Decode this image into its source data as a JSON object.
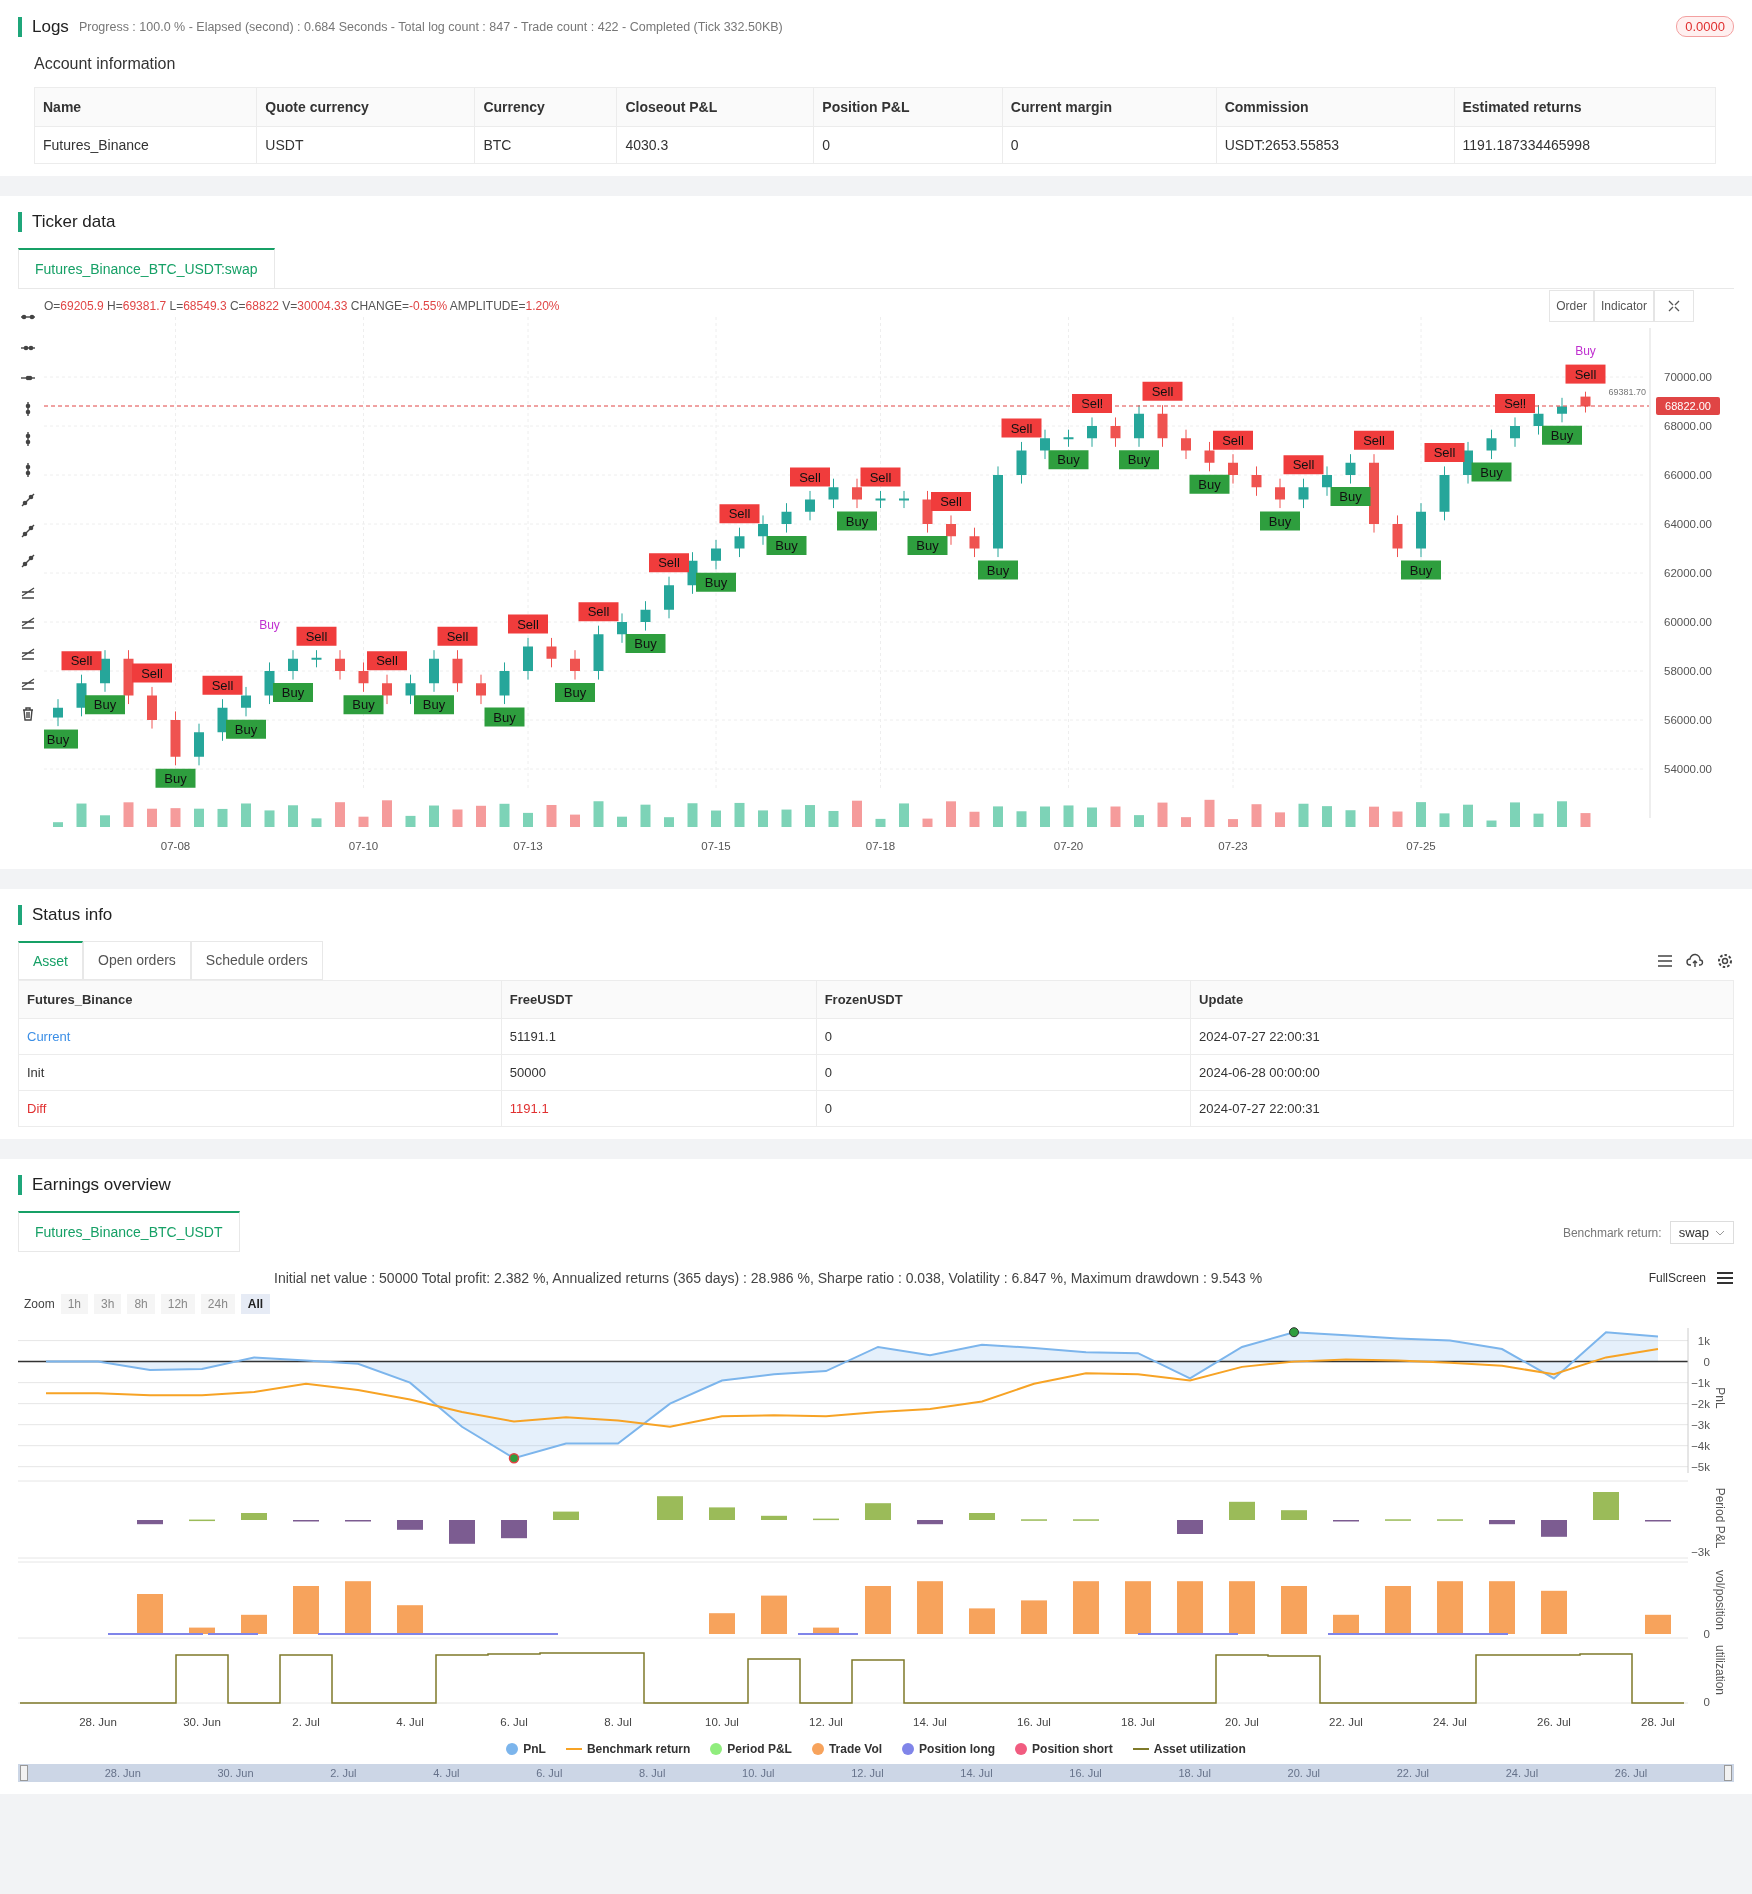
{
  "logs": {
    "title": "Logs",
    "stats": "Progress : 100.0 % - Elapsed (second) : 0.684  Seconds - Total log count : 847 - Trade count : 422 - Completed (Tick 332.50KB)",
    "badge": "0.0000"
  },
  "account": {
    "title": "Account information",
    "columns": [
      "Name",
      "Quote currency",
      "Currency",
      "Closeout P&L",
      "Position P&L",
      "Current margin",
      "Commission",
      "Estimated returns"
    ],
    "rows": [
      [
        "Futures_Binance",
        "USDT",
        "BTC",
        "4030.3",
        "0",
        "0",
        "USDT:2653.55853",
        "1191.187334465998"
      ]
    ]
  },
  "ticker": {
    "title": "Ticker data",
    "tab": "Futures_Binance_BTC_USDT:swap",
    "ohlc": [
      {
        "label": "O=",
        "value": "69205.9"
      },
      {
        "label": "H=",
        "value": "69381.7"
      },
      {
        "label": "L=",
        "value": "68549.3"
      },
      {
        "label": "C=",
        "value": "68822"
      },
      {
        "label": "V=",
        "value": "30004.33"
      },
      {
        "label": "CHANGE=",
        "value": "-0.55%"
      },
      {
        "label": "AMPLITUDE=",
        "value": "1.20%"
      }
    ],
    "buttons": [
      "Order",
      "Indicator"
    ],
    "high_label": "69381.70",
    "last_price": "68822.00",
    "chart_data": {
      "type": "candlestick",
      "grid": true,
      "ylim": [
        52000,
        72000
      ],
      "categories": [
        null,
        null,
        null,
        null,
        null,
        "07-08",
        null,
        null,
        null,
        null,
        null,
        null,
        null,
        "07-10",
        null,
        null,
        null,
        null,
        null,
        null,
        "07-13",
        null,
        null,
        null,
        null,
        null,
        null,
        null,
        "07-15",
        null,
        null,
        null,
        null,
        null,
        null,
        "07-18",
        null,
        null,
        null,
        null,
        null,
        null,
        null,
        "07-20",
        null,
        null,
        null,
        null,
        null,
        null,
        "07-23",
        null,
        null,
        null,
        null,
        null,
        null,
        null,
        "07-25",
        null,
        null,
        null,
        null,
        null,
        null,
        null
      ],
      "yticks": [
        {
          "value": 54000,
          "label": "54000.00"
        },
        {
          "value": 56000,
          "label": "56000.00"
        },
        {
          "value": 58000,
          "label": "58000.00"
        },
        {
          "value": 60000,
          "label": "60000.00"
        },
        {
          "value": 62000,
          "label": "62000.00"
        },
        {
          "value": 64000,
          "label": "64000.00"
        },
        {
          "value": 66000,
          "label": "66000.00"
        },
        {
          "value": 68000,
          "label": "68000.00"
        },
        {
          "value": 70000,
          "label": "70000.00"
        }
      ],
      "ohlc": [
        [
          56100,
          56850,
          55750,
          56500
        ],
        [
          56500,
          57850,
          56150,
          57500
        ],
        [
          57500,
          58850,
          57150,
          58500
        ],
        [
          58500,
          58850,
          56650,
          57000
        ],
        [
          57000,
          57350,
          55650,
          56000
        ],
        [
          56000,
          56350,
          54150,
          54500
        ],
        [
          54500,
          55850,
          54150,
          55500
        ],
        [
          55500,
          56850,
          55150,
          56500
        ],
        [
          56500,
          57350,
          56150,
          57000
        ],
        [
          57000,
          58350,
          56650,
          58000
        ],
        [
          58000,
          58850,
          57650,
          58500
        ],
        [
          58500,
          58850,
          58150,
          58500
        ],
        [
          58500,
          58850,
          57650,
          58000
        ],
        [
          58000,
          58350,
          57150,
          57500
        ],
        [
          57500,
          57850,
          56650,
          57000
        ],
        [
          57000,
          57850,
          56650,
          57500
        ],
        [
          57500,
          58850,
          57150,
          58500
        ],
        [
          58500,
          58850,
          57150,
          57500
        ],
        [
          57500,
          57850,
          56650,
          57000
        ],
        [
          57000,
          58350,
          56650,
          58000
        ],
        [
          58000,
          59350,
          57650,
          59000
        ],
        [
          59000,
          59350,
          58150,
          58500
        ],
        [
          58500,
          58850,
          57650,
          58000
        ],
        [
          58000,
          59850,
          57650,
          59500
        ],
        [
          59500,
          60350,
          59150,
          60000
        ],
        [
          60000,
          60850,
          59650,
          60500
        ],
        [
          60500,
          61850,
          60150,
          61500
        ],
        [
          61500,
          62850,
          61150,
          62500
        ],
        [
          62500,
          63350,
          62150,
          63000
        ],
        [
          63000,
          63850,
          62650,
          63500
        ],
        [
          63500,
          64350,
          63150,
          64000
        ],
        [
          64000,
          64850,
          63650,
          64500
        ],
        [
          64500,
          65350,
          64150,
          65000
        ],
        [
          65000,
          65850,
          64650,
          65500
        ],
        [
          65500,
          65850,
          64650,
          65000
        ],
        [
          65000,
          65350,
          64650,
          65000
        ],
        [
          65000,
          65350,
          64650,
          65000
        ],
        [
          65000,
          65350,
          63650,
          64000
        ],
        [
          64000,
          64350,
          63150,
          63500
        ],
        [
          63500,
          63850,
          62650,
          63000
        ],
        [
          63000,
          66350,
          62650,
          66000
        ],
        [
          66000,
          67350,
          65650,
          67000
        ],
        [
          67000,
          67850,
          66650,
          67500
        ],
        [
          67500,
          67850,
          67150,
          67500
        ],
        [
          67500,
          68350,
          67150,
          68000
        ],
        [
          68000,
          68350,
          67150,
          67500
        ],
        [
          67500,
          68850,
          67150,
          68500
        ],
        [
          68500,
          68850,
          67150,
          67500
        ],
        [
          67500,
          67850,
          66650,
          67000
        ],
        [
          67000,
          67350,
          66150,
          66500
        ],
        [
          66500,
          66850,
          65650,
          66000
        ],
        [
          66000,
          66350,
          65150,
          65500
        ],
        [
          65500,
          65850,
          64650,
          65000
        ],
        [
          65000,
          65850,
          64650,
          65500
        ],
        [
          65500,
          66350,
          65150,
          66000
        ],
        [
          66000,
          66850,
          65650,
          66500
        ],
        [
          66500,
          66850,
          63650,
          64000
        ],
        [
          64000,
          64350,
          62650,
          63000
        ],
        [
          63000,
          64850,
          62650,
          64500
        ],
        [
          64500,
          66350,
          64150,
          66000
        ],
        [
          66000,
          67350,
          65650,
          67000
        ],
        [
          67000,
          67850,
          66650,
          67500
        ],
        [
          67500,
          68350,
          67150,
          68000
        ],
        [
          68000,
          68850,
          67650,
          68500
        ],
        [
          68500,
          69150,
          68150,
          68800
        ],
        [
          69200,
          69400,
          68550,
          68800
        ]
      ]
    },
    "markers": [
      {
        "text": "Buy",
        "kind": "buy"
      },
      {
        "text": "Sell",
        "kind": "sell"
      },
      {
        "text": "Buy",
        "kind": "buy"
      },
      {
        "text": "Sell",
        "kind": "sell"
      },
      {
        "text": "Buy",
        "kind": "buy"
      },
      {
        "text": "Sell",
        "kind": "sell"
      },
      {
        "text": "Buy",
        "kind": "buy"
      },
      {
        "text": "Buy",
        "kind": "tag"
      },
      {
        "text": "Buy",
        "kind": "buy"
      },
      {
        "text": "Sell",
        "kind": "sell"
      },
      {
        "text": "Buy",
        "kind": "buy"
      },
      {
        "text": "Sell",
        "kind": "sell"
      },
      {
        "text": "Buy",
        "kind": "buy"
      },
      {
        "text": "Sell",
        "kind": "sell"
      },
      {
        "text": "Buy",
        "kind": "buy"
      },
      {
        "text": "Sell",
        "kind": "sell"
      },
      {
        "text": "Buy",
        "kind": "buy"
      },
      {
        "text": "Sell",
        "kind": "sell"
      },
      {
        "text": "Buy",
        "kind": "buy"
      },
      {
        "text": "Sell",
        "kind": "sell"
      },
      {
        "text": "Buy",
        "kind": "buy"
      },
      {
        "text": "Sell",
        "kind": "sell"
      },
      {
        "text": "Buy",
        "kind": "buy"
      },
      {
        "text": "Sell",
        "kind": "sell"
      },
      {
        "text": "Buy",
        "kind": "buy"
      },
      {
        "text": "Sell",
        "kind": "sell"
      },
      {
        "text": "Buy",
        "kind": "buy"
      },
      {
        "text": "Sell",
        "kind": "sell"
      },
      {
        "text": "Buy",
        "kind": "buy"
      },
      {
        "text": "Sell",
        "kind": "sell"
      },
      {
        "text": "Buy",
        "kind": "buy"
      },
      {
        "text": "Sell",
        "kind": "sell"
      },
      {
        "text": "Buy",
        "kind": "buy"
      },
      {
        "text": "Sell",
        "kind": "sell"
      },
      {
        "text": "Buy",
        "kind": "buy"
      },
      {
        "text": "Sell",
        "kind": "sell"
      },
      {
        "text": "Buy",
        "kind": "buy"
      },
      {
        "text": "Sell",
        "kind": "sell"
      },
      {
        "text": "Buy",
        "kind": "buy"
      },
      {
        "text": "Sell",
        "kind": "sell"
      },
      {
        "text": "Buy",
        "kind": "buy"
      },
      {
        "text": "Sell",
        "kind": "sell"
      },
      {
        "text": "Buy",
        "kind": "buy"
      },
      {
        "text": "Sell",
        "kind": "sell"
      },
      {
        "text": "Buy",
        "kind": "buy"
      },
      {
        "text": "Sell",
        "kind": "sell"
      },
      {
        "text": "Buy",
        "kind": "tag"
      }
    ]
  },
  "status": {
    "title": "Status info",
    "tabs": [
      {
        "label": "Asset",
        "selected": true
      },
      {
        "label": "Open orders",
        "selected": false
      },
      {
        "label": "Schedule orders",
        "selected": false
      }
    ],
    "columns": [
      "Futures_Binance",
      "FreeUSDT",
      "FrozenUSDT",
      "Update"
    ],
    "rows": [
      {
        "kind": "current",
        "cells": [
          "Current",
          "51191.1",
          "0",
          "2024-07-27 22:00:31"
        ]
      },
      {
        "kind": "init",
        "cells": [
          "Init",
          "50000",
          "0",
          "2024-06-28 00:00:00"
        ]
      },
      {
        "kind": "diff",
        "cells": [
          "Diff",
          "1191.1",
          "0",
          "2024-07-27 22:00:31"
        ]
      }
    ]
  },
  "earnings": {
    "title": "Earnings overview",
    "tab": "Futures_Binance_BTC_USDT",
    "benchmark_label": "Benchmark return:",
    "benchmark_value": "swap",
    "summary": "Initial net value : 50000 Total profit: 2.382 %, Annualized returns (365 days) : 28.986 %, Sharpe ratio : 0.038, Volatility : 6.847 %, Maximum drawdown : 9.543 %",
    "fullscreen": "FullScreen",
    "zoom_label": "Zoom",
    "zoom_buttons": [
      {
        "label": "1h",
        "selected": false
      },
      {
        "label": "3h",
        "selected": false
      },
      {
        "label": "8h",
        "selected": false
      },
      {
        "label": "12h",
        "selected": false
      },
      {
        "label": "24h",
        "selected": false
      },
      {
        "label": "All",
        "selected": true
      }
    ],
    "pnl_title": "PnL",
    "chart_data": {
      "type": "line",
      "grid": true,
      "ylim": [
        -5300,
        1600
      ],
      "yticks": [
        {
          "value": 1000,
          "label": "1k"
        },
        {
          "value": 0,
          "label": "0"
        },
        {
          "value": -1000,
          "label": "−1k"
        },
        {
          "value": -2000,
          "label": "−2k"
        },
        {
          "value": -3000,
          "label": "−3k"
        },
        {
          "value": -4000,
          "label": "−4k"
        },
        {
          "value": -5000,
          "label": "−5k"
        }
      ],
      "series": [
        {
          "name": "PnL",
          "color": "#7cb5ec",
          "values": [
            0,
            0,
            -400,
            -350,
            200,
            50,
            -100,
            -1000,
            -3100,
            -4600,
            -3900,
            -3900,
            -2000,
            -900,
            -600,
            -450,
            700,
            300,
            800,
            650,
            450,
            400,
            -800,
            700,
            1400,
            1250,
            1100,
            1000,
            600,
            -800,
            1400,
            1200
          ]
        },
        {
          "name": "Benchmark return",
          "color": "#f7a325",
          "values": [
            -1500,
            -1500,
            -1600,
            -1600,
            -1450,
            -1050,
            -1350,
            -1800,
            -2400,
            -2850,
            -2650,
            -2800,
            -3100,
            -2600,
            -2550,
            -2600,
            -2400,
            -2250,
            -1900,
            -1050,
            -550,
            -600,
            -900,
            -250,
            0,
            100,
            50,
            -50,
            -200,
            -600,
            200,
            600
          ]
        }
      ]
    },
    "x_labels": [
      "28. Jun",
      "30. Jun",
      "2. Jul",
      "4. Jul",
      "6. Jul",
      "8. Jul",
      "10. Jul",
      "12. Jul",
      "14. Jul",
      "16. Jul",
      "18. Jul",
      "20. Jul",
      "22. Jul",
      "24. Jul",
      "26. Jul",
      "28. Jul"
    ],
    "panels": [
      {
        "kind": "period",
        "title": "Period P&L",
        "tick": "−3k"
      },
      {
        "kind": "volume",
        "title": "vol/position",
        "tick": "0"
      },
      {
        "kind": "utilization",
        "title": "utilization",
        "tick": "0"
      }
    ],
    "legend": [
      {
        "color": "#7cb5ec",
        "kind": "dot"
      },
      {
        "color": "#f7a325",
        "kind": "line"
      },
      {
        "label": "Period P&L",
        "color": "#90ed7d",
        "kind": "dot"
      },
      {
        "label": "Trade Vol",
        "color": "#f7a35c",
        "kind": "dot"
      },
      {
        "label": "Position long",
        "color": "#8085e9",
        "kind": "dot"
      },
      {
        "label": "Position short",
        "color": "#f15c80",
        "kind": "dot"
      },
      {
        "label": "Asset utilization",
        "color": "#7f7a2a",
        "kind": "line"
      }
    ],
    "navigator": [
      "28. Jun",
      "30. Jun",
      "2. Jul",
      "4. Jul",
      "6. Jul",
      "8. Jul",
      "10. Jul",
      "12. Jul",
      "14. Jul",
      "16. Jul",
      "18. Jul",
      "20. Jul",
      "22. Jul",
      "24. Jul",
      "26. Jul"
    ]
  }
}
